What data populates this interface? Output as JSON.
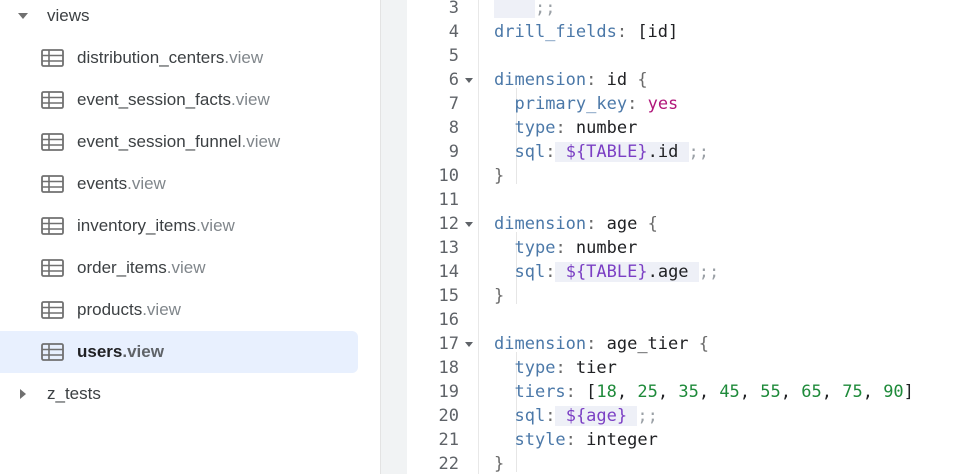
{
  "sidebar": {
    "folders": [
      {
        "label": "views",
        "expanded": true
      },
      {
        "label": "z_tests",
        "expanded": false
      }
    ],
    "files": [
      {
        "name": "distribution_centers",
        "ext": ".view",
        "icon": "table-icon"
      },
      {
        "name": "event_session_facts",
        "ext": ".view",
        "icon": "table-icon"
      },
      {
        "name": "event_session_funnel",
        "ext": ".view",
        "icon": "table-icon"
      },
      {
        "name": "events",
        "ext": ".view",
        "icon": "table-icon"
      },
      {
        "name": "inventory_items",
        "ext": ".view",
        "icon": "table-icon"
      },
      {
        "name": "order_items",
        "ext": ".view",
        "icon": "table-icon"
      },
      {
        "name": "products",
        "ext": ".view",
        "icon": "table-icon"
      },
      {
        "name": "users",
        "ext": ".view",
        "icon": "table-icon",
        "selected": true
      }
    ]
  },
  "editor": {
    "lines": [
      {
        "n": "3",
        "html": "<span class=\"sqlbg\">    </span><span class=\"semi\">;;</span>"
      },
      {
        "n": "4",
        "html": "<span class=\"k\">drill_fields</span><span class=\"p\">:</span> [id]"
      },
      {
        "n": "5",
        "html": ""
      },
      {
        "n": "6",
        "fold": true,
        "html": "<span class=\"k\">dimension</span><span class=\"p\">:</span> id <span class=\"p\">{</span>"
      },
      {
        "n": "7",
        "html": "  <span class=\"k\">primary_key</span><span class=\"p\">:</span> <span class=\"y\">yes</span>"
      },
      {
        "n": "8",
        "html": "  <span class=\"k\">type</span><span class=\"p\">:</span> number"
      },
      {
        "n": "9",
        "html": "  <span class=\"k\">sql</span><span class=\"p\">:</span><span class=\"sqlbg\"> <span class=\"s\">${TABLE}</span>.id </span><span class=\"semi\">;;</span>"
      },
      {
        "n": "10",
        "html": "<span class=\"p\">}</span>"
      },
      {
        "n": "11",
        "html": ""
      },
      {
        "n": "12",
        "fold": true,
        "html": "<span class=\"k\">dimension</span><span class=\"p\">:</span> age <span class=\"p\">{</span>"
      },
      {
        "n": "13",
        "html": "  <span class=\"k\">type</span><span class=\"p\">:</span> number"
      },
      {
        "n": "14",
        "html": "  <span class=\"k\">sql</span><span class=\"p\">:</span><span class=\"sqlbg\"> <span class=\"s\">${TABLE}</span>.age </span><span class=\"semi\">;;</span>"
      },
      {
        "n": "15",
        "html": "<span class=\"p\">}</span>"
      },
      {
        "n": "16",
        "html": ""
      },
      {
        "n": "17",
        "fold": true,
        "html": "<span class=\"k\">dimension</span><span class=\"p\">:</span> age_tier <span class=\"p\">{</span>"
      },
      {
        "n": "18",
        "html": "  <span class=\"k\">type</span><span class=\"p\">:</span> tier"
      },
      {
        "n": "19",
        "html": "  <span class=\"k\">tiers</span><span class=\"p\">:</span> [<span class=\"n\">18</span>, <span class=\"n\">25</span>, <span class=\"n\">35</span>, <span class=\"n\">45</span>, <span class=\"n\">55</span>, <span class=\"n\">65</span>, <span class=\"n\">75</span>, <span class=\"n\">90</span>]"
      },
      {
        "n": "20",
        "html": "  <span class=\"k\">sql</span><span class=\"p\">:</span><span class=\"sqlbg\"> <span class=\"s\">${age}</span> </span><span class=\"semi\">;;</span>"
      },
      {
        "n": "21",
        "html": "  <span class=\"k\">style</span><span class=\"p\">:</span> integer"
      },
      {
        "n": "22",
        "html": "<span class=\"p\">}</span>"
      }
    ]
  }
}
